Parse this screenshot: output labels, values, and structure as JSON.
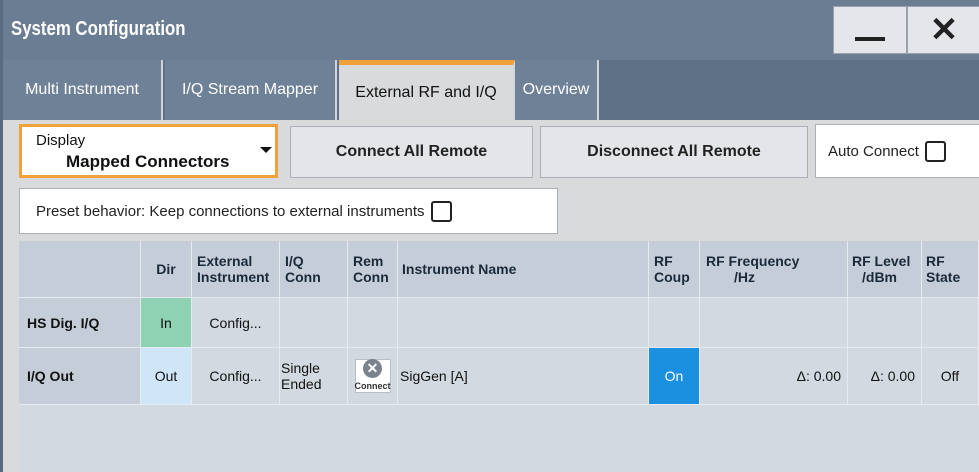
{
  "window": {
    "title": "System Configuration",
    "minimize_icon": "minimize-icon",
    "close_icon": "close-icon",
    "close_glyph": "✕"
  },
  "tabs": [
    {
      "label": "Multi Instrument",
      "active": false
    },
    {
      "label": "I/Q Stream Mapper",
      "active": false
    },
    {
      "label": "External RF and I/Q",
      "active": true
    },
    {
      "label": "Overview",
      "active": false
    }
  ],
  "display": {
    "label": "Display",
    "value": "Mapped Connectors"
  },
  "buttons": {
    "connect_all": "Connect All Remote",
    "disconnect_all": "Disconnect All Remote"
  },
  "auto_connect": {
    "label": "Auto Connect",
    "checked": false
  },
  "preset": {
    "label": "Preset behavior: Keep connections to external instruments",
    "checked": false
  },
  "table": {
    "headers": {
      "dir": "Dir",
      "ext_instr": [
        "External",
        "Instrument"
      ],
      "iq_conn": [
        "I/Q",
        "Conn"
      ],
      "rem_conn": [
        "Rem",
        "Conn"
      ],
      "inst_name": "Instrument Name",
      "rf_coup": [
        "RF",
        "Coup"
      ],
      "rf_freq": [
        "RF Frequency",
        "/Hz"
      ],
      "rf_level": [
        "RF Level",
        "/dBm"
      ],
      "rf_state": [
        "RF",
        "State"
      ]
    },
    "rows": [
      {
        "label": "HS Dig. I/Q",
        "dir": "In",
        "ext_instr": "Config...",
        "iq_conn": "",
        "rem_conn": "",
        "inst_name": "",
        "rf_coup": "",
        "rf_freq": "",
        "rf_level": "",
        "rf_state": ""
      },
      {
        "label": "I/Q Out",
        "dir": "Out",
        "ext_instr": "Config...",
        "iq_conn": [
          "Single",
          "Ended"
        ],
        "rem_conn_label": "Connect",
        "inst_name": "SigGen [A]",
        "rf_coup": "On",
        "rf_freq": "Δ: 0.00",
        "rf_level": "Δ: 0.00",
        "rf_state": "Off"
      }
    ]
  },
  "colors": {
    "titlebar": "#6b7d92",
    "tab_active_accent": "#f0a13a",
    "dir_in": "#8fd1b3",
    "dir_out": "#cfe6f8",
    "rf_on": "#1b8fe0"
  }
}
